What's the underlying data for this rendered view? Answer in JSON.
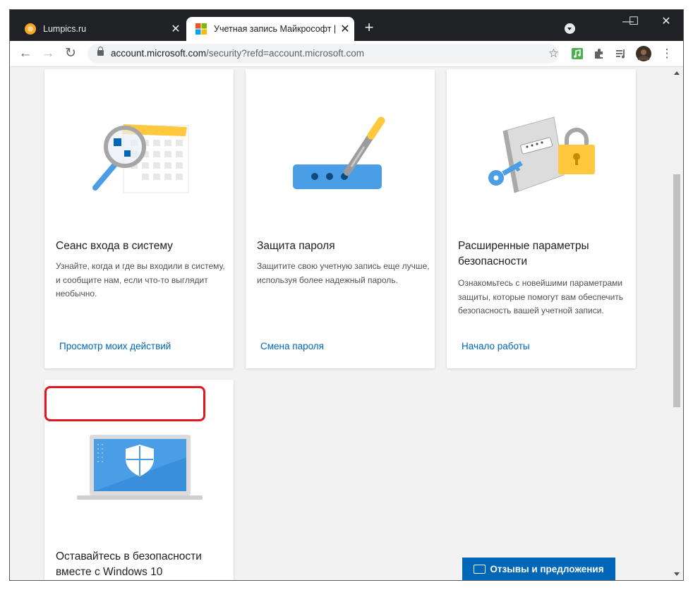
{
  "browser": {
    "tabs": [
      {
        "title": "Lumpics.ru",
        "active": false,
        "favicon": "lumpics-orange-circle"
      },
      {
        "title": "Учетная запись Майкрософт | S",
        "active": true,
        "favicon": "microsoft-logo"
      }
    ],
    "close_glyph": "✕",
    "new_tab_glyph": "+",
    "window_controls": {
      "minimize": "—",
      "maximize": "☐",
      "close": "✕"
    },
    "url_host": "account.microsoft.com",
    "url_path": "/security?refd=account.microsoft.com",
    "nav": {
      "back": "←",
      "forward": "→",
      "reload": "↻",
      "star": "☆",
      "menu": "⋮"
    }
  },
  "cards": [
    {
      "title": "Сеанс входа в систему",
      "description": "Узнайте, когда и где вы входили в систему, и сообщите нам, если что-то выглядит необычно.",
      "link": "Просмотр моих действий",
      "illustration": "magnifier-calendar-icon"
    },
    {
      "title": "Защита пароля",
      "description": "Защитите свою учетную запись еще лучше, используя более надежный пароль.",
      "link": "Смена пароля",
      "illustration": "password-pen-icon"
    },
    {
      "title": "Расширенные параметры безопасности",
      "description": "Ознакомьтесь с новейшими параметрами защиты, которые помогут вам обеспечить безопасность вашей учетной записи.",
      "link": "Начало работы",
      "illustration": "notebook-lock-key-icon"
    },
    {
      "title": "Оставайтесь в безопасности вместе с Windows 10",
      "illustration": "laptop-shield-icon"
    }
  ],
  "feedback_button": "Отзывы и предложения",
  "colors": {
    "link": "#0067b8",
    "highlight": "#e0171f",
    "accent_yellow": "#ffc83d",
    "accent_blue": "#4a9ee6"
  }
}
